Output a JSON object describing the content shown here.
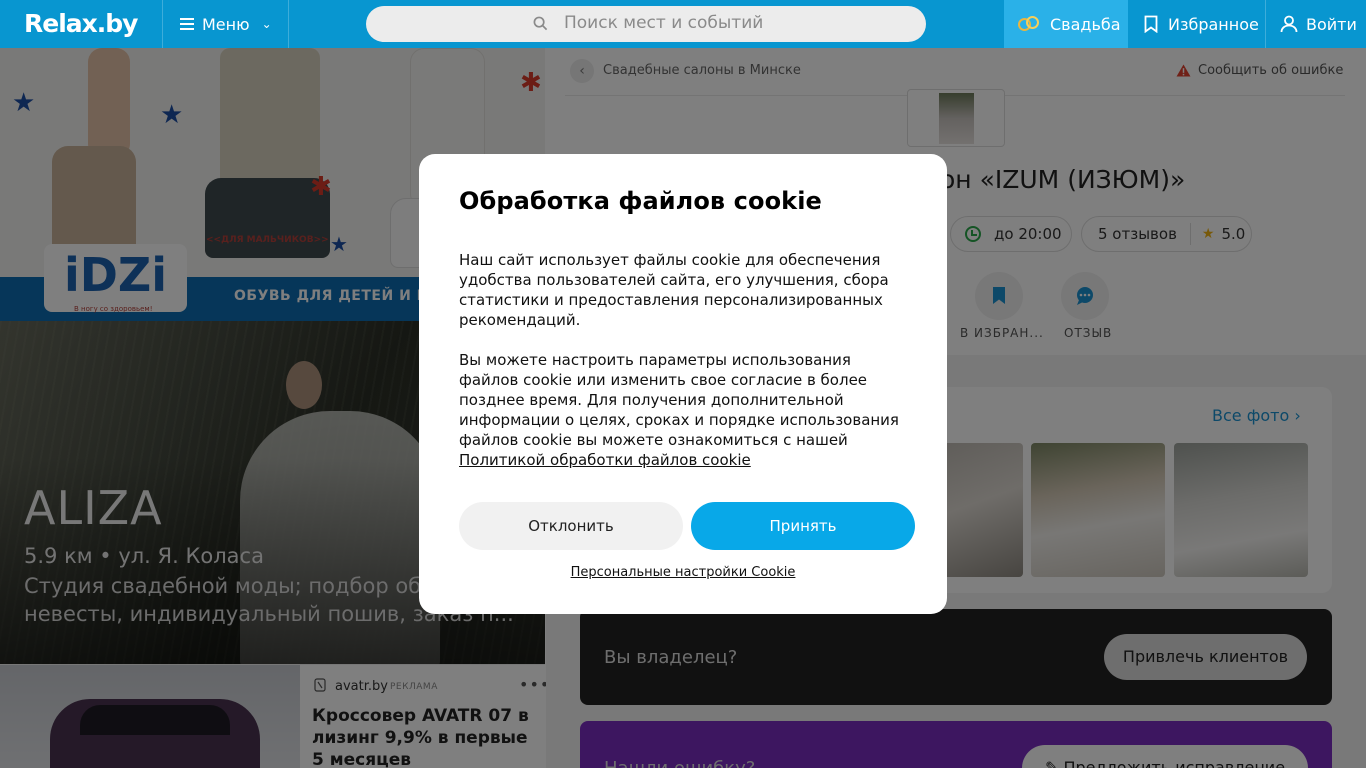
{
  "header": {
    "logo": "Relax.by",
    "menu_label": "Меню",
    "search_placeholder": "Поиск мест и событий",
    "wedding_label": "Свадьба",
    "favorites_label": "Избранное",
    "login_label": "Войти",
    "colors": {
      "bar": "#0896d0",
      "wedding_tab": "#2ab1e8"
    }
  },
  "left": {
    "banner": {
      "caption": "<<ДЛЯ МАЛЬЧИКОВ>>",
      "brand": "iDZi",
      "brand_slogan": "В ногу со здоровьем!",
      "strip_text": "ОБУВЬ ДЛЯ ДЕТЕЙ И П"
    },
    "promo": {
      "title": "ALIZA",
      "address": "5.9 км • ул. Я. Коласа",
      "description": "Студия свадебной моды; подбор об невесты, индивидуальный пошив, заказ п..."
    },
    "ad": {
      "source": "avatr.by",
      "tag": "РЕКЛАМА",
      "menu_icon": "more-dots-icon",
      "headline": "Кроссовер AVATR 07 в лизинг 9,9% в первые 5 месяцев"
    }
  },
  "page": {
    "breadcrumb": "Свадебные салоны в Минске",
    "report_label": "Сообщить об ошибке",
    "title": "он «IZUM (ИЗЮМ)»",
    "hours": "до 20:00",
    "reviews": "5 отзывов",
    "rating": "5.0",
    "actions": [
      {
        "label": "В ИЗБРАН...",
        "icon": "bookmark-icon"
      },
      {
        "label": "ОТЗЫВ",
        "icon": "comment-icon"
      }
    ],
    "all_photos_label": "Все фото",
    "owner_question": "Вы владелец?",
    "owner_button": "Привлечь клиентов",
    "mistake_question": "Нашли ошибку?",
    "mistake_button": "Предложить исправление",
    "accent_color": "#1a93d2"
  },
  "cookie": {
    "title": "Обработка файлов cookie",
    "paragraph1": "Наш сайт использует файлы cookie для обеспечения удобства пользователей сайта, его улучшения, сбора статистики и предоставления персонализированных рекомендаций.",
    "paragraph2": "Вы можете настроить параметры использования файлов cookie или изменить свое согласие в более позднее время. Для получения дополнительной информации о целях, сроках и порядке использования файлов cookie вы можете ознакомиться с нашей",
    "policy_link": "Политикой обработки файлов cookie",
    "decline_label": "Отклонить",
    "accept_label": "Принять",
    "personal_settings_label": "Персональные настройки Cookie",
    "accept_color": "#08a8e8"
  }
}
